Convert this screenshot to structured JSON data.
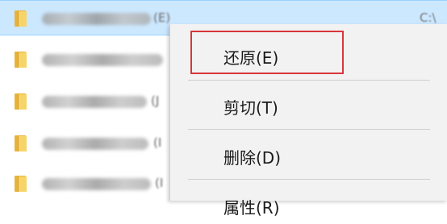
{
  "file_list": {
    "rows": [
      {
        "tail": "(E)",
        "col2": "C:\\"
      },
      {
        "tail": "",
        "col2": ""
      },
      {
        "tail": "(J",
        "col2": ""
      },
      {
        "tail": "(I",
        "col2": ""
      },
      {
        "tail": "(I",
        "col2": ""
      }
    ]
  },
  "context_menu": {
    "items": [
      {
        "label": "还原(E)"
      },
      {
        "label": "剪切(T)"
      },
      {
        "label": "删除(D)"
      },
      {
        "label": "属性(R)"
      }
    ]
  },
  "colors": {
    "selection": "#cce8ff",
    "highlight_border": "#d9363a",
    "menu_background": "#f2f2f2"
  }
}
